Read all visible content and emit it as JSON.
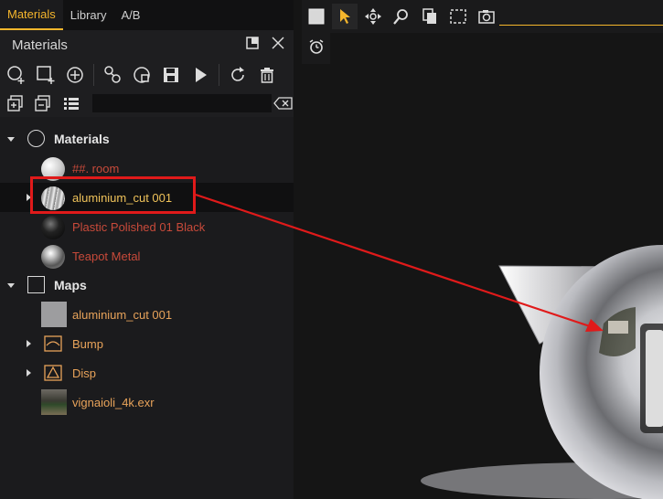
{
  "tabs": [
    "Materials",
    "Library",
    "A/B"
  ],
  "panel": {
    "title": "Materials"
  },
  "search": {
    "value": ""
  },
  "tree": {
    "materials_group": "Materials",
    "materials": [
      {
        "label": "##. room",
        "color": "red"
      },
      {
        "label": "aluminium_cut 001",
        "color": "yellow",
        "selected": true
      },
      {
        "label": "Plastic Polished 01 Black",
        "color": "red"
      },
      {
        "label": "Teapot Metal",
        "color": "red"
      }
    ],
    "maps_group": "Maps",
    "maps": [
      {
        "label": "aluminium_cut 001"
      },
      {
        "label": "Bump"
      },
      {
        "label": "Disp"
      },
      {
        "label": "vignaioli_4k.exr"
      }
    ]
  },
  "colors": {
    "accent": "#f5b62c",
    "highlight": "#e01a1a",
    "panel_bg": "#1b1b1d"
  }
}
